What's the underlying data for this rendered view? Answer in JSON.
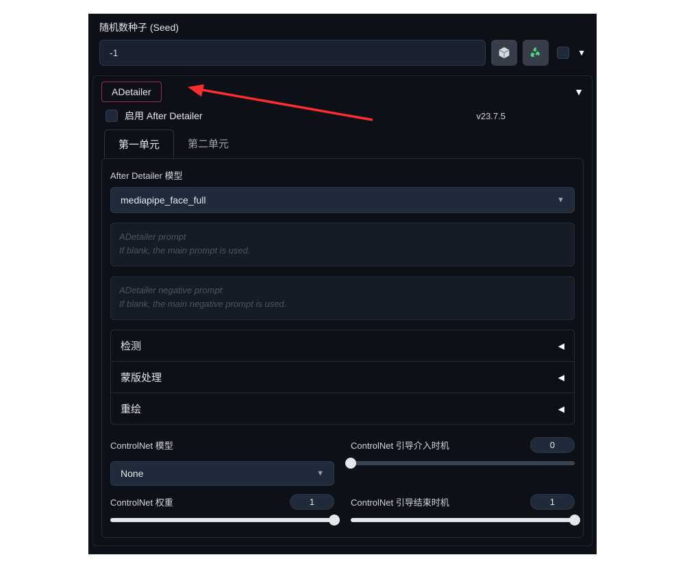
{
  "seed": {
    "label": "随机数种子 (Seed)",
    "value": "-1",
    "dice_icon": "dice-icon",
    "recycle_icon": "recycle-icon"
  },
  "adetailer": {
    "title": "ADetailer",
    "enable_label": "启用 After Detailer",
    "version": "v23.7.5",
    "tabs": [
      "第一单元",
      "第二单元"
    ],
    "model_label": "After Detailer 模型",
    "model_value": "mediapipe_face_full",
    "prompt_placeholder_line1": "ADetailer prompt",
    "prompt_placeholder_line2": "If blank, the main prompt is used.",
    "neg_placeholder_line1": "ADetailer negative prompt",
    "neg_placeholder_line2": "If blank, the main negative prompt is used.",
    "accordion": [
      "检测",
      "蒙版处理",
      "重绘"
    ],
    "controlnet": {
      "model_label": "ControlNet 模型",
      "model_value": "None",
      "weight_label": "ControlNet 权重",
      "weight_value": "1",
      "guidance_start_label": "ControlNet 引导介入时机",
      "guidance_start_value": "0",
      "guidance_end_label": "ControlNet 引导结束时机",
      "guidance_end_value": "1"
    }
  }
}
